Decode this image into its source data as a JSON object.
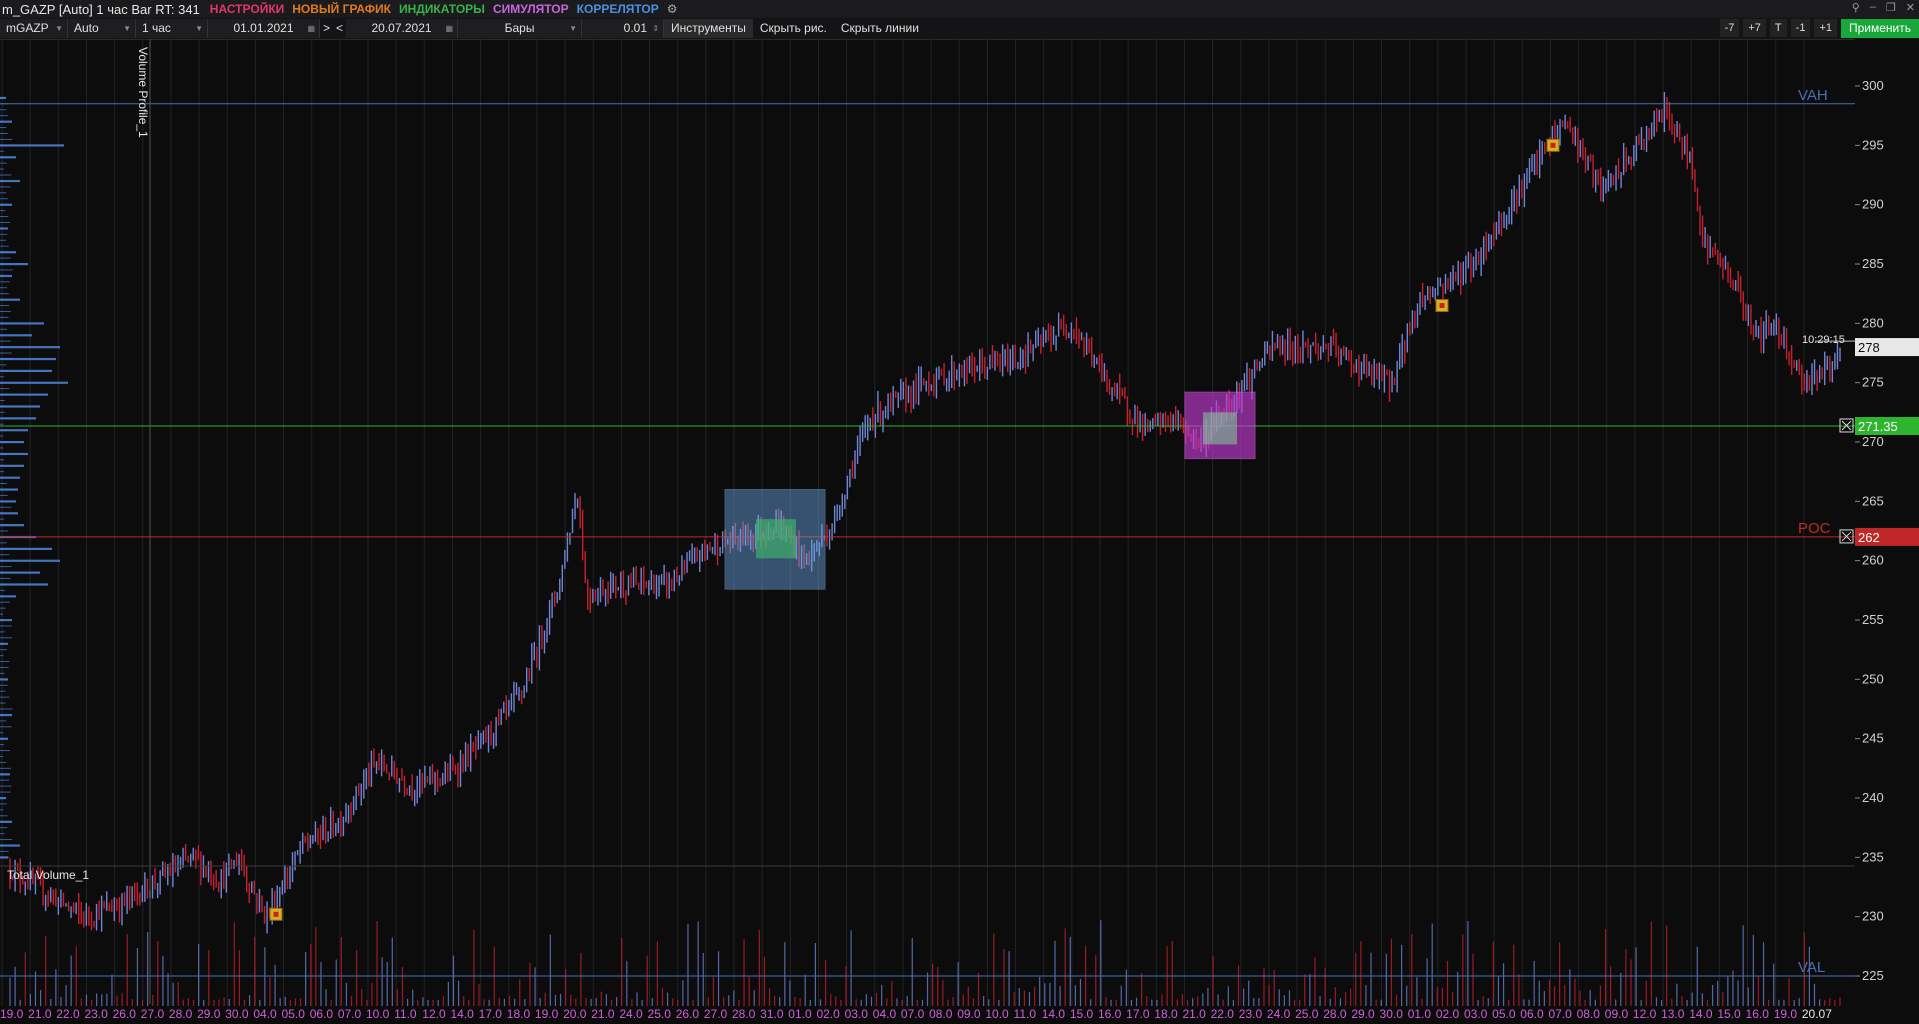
{
  "window": {
    "title": "m_GAZP [Auto] 1 час Bar RT: 341",
    "menus": [
      {
        "label": "НАСТРОЙКИ",
        "color": "#e2366b"
      },
      {
        "label": "НОВЫЙ ГРАФИК",
        "color": "#e07a22"
      },
      {
        "label": "ИНДИКАТОРЫ",
        "color": "#35b24a"
      },
      {
        "label": "СИМУЛЯТОР",
        "color": "#c765e0"
      },
      {
        "label": "КОРРЕЛЯТОР",
        "color": "#4a90e2"
      }
    ],
    "settings_icon": "gears-icon",
    "controls": [
      "pin-icon",
      "minimize-icon",
      "restore-icon",
      "close-icon"
    ]
  },
  "toolbar": {
    "symbol": "mGAZP",
    "scale": "Auto",
    "timeframe": "1 час",
    "date_from": "01.01.2021",
    "nav_forward": ">",
    "nav_back": "<",
    "date_to": "20.07.2021",
    "chart_type": "Бары",
    "step": "0.01",
    "instruments": "Инструменты",
    "hide_drawings": "Скрыть рис.",
    "hide_lines": "Скрыть линии",
    "right_buttons": [
      "-7",
      "+7",
      "T",
      "-1",
      "+1"
    ],
    "apply": "Применить"
  },
  "chart": {
    "panel_label": "Volume Profile_1",
    "volume_label": "Total Volume_1",
    "current_time": "10:29:15",
    "colors": {
      "up": "#6f86d6",
      "down": "#c8202d",
      "profile": "#4a7fd4",
      "grid": "#232326"
    },
    "levels": [
      {
        "name": "VAH",
        "price": 298.5,
        "color": "#4a6fb0",
        "label": "VAH"
      },
      {
        "name": "level",
        "price": 271.35,
        "color": "#2db52d",
        "tag": "271.35"
      },
      {
        "name": "POC",
        "price": 262,
        "color": "#c02828",
        "label": "POC",
        "tag": "262"
      },
      {
        "name": "VAL",
        "price": 225,
        "color": "#4a6fb0",
        "label": "VAL"
      }
    ],
    "price_ticks": [
      "300",
      "295",
      "290",
      "285",
      "280",
      "275",
      "270",
      "265",
      "260",
      "255",
      "250",
      "245",
      "240",
      "235",
      "230",
      "225"
    ],
    "current_price": "278",
    "date_ticks": [
      "19.0",
      "21.0",
      "22.0",
      "23.0",
      "26.0",
      "27.0",
      "28.0",
      "29.0",
      "30.0",
      "04.0",
      "05.0",
      "06.0",
      "07.0",
      "10.0",
      "11.0",
      "12.0",
      "14.0",
      "17.0",
      "18.0",
      "19.0",
      "20.0",
      "21.0",
      "24.0",
      "25.0",
      "26.0",
      "27.0",
      "28.0",
      "31.0",
      "01.0",
      "02.0",
      "03.0",
      "04.0",
      "07.0",
      "08.0",
      "09.0",
      "10.0",
      "11.0",
      "14.0",
      "15.0",
      "16.0",
      "17.0",
      "18.0",
      "21.0",
      "22.0",
      "23.0",
      "24.0",
      "25.0",
      "28.0",
      "29.0",
      "30.0",
      "01.0",
      "02.0",
      "03.0",
      "05.0",
      "06.0",
      "07.0",
      "08.0",
      "09.0",
      "12.0",
      "13.0",
      "14.0",
      "15.0",
      "16.0",
      "19.0",
      "20.07"
    ],
    "boxes": [
      {
        "name": "blue-zone-box",
        "color": "#6aa7e6"
      },
      {
        "name": "magenta-zone-box",
        "color": "#c23bd0"
      }
    ],
    "price_path": [
      [
        0,
        234
      ],
      [
        0.02,
        232
      ],
      [
        0.04,
        230
      ],
      [
        0.06,
        231
      ],
      [
        0.08,
        233
      ],
      [
        0.1,
        235
      ],
      [
        0.115,
        233
      ],
      [
        0.125,
        235
      ],
      [
        0.13,
        233
      ],
      [
        0.14,
        230
      ],
      [
        0.16,
        236
      ],
      [
        0.18,
        238
      ],
      [
        0.2,
        243
      ],
      [
        0.22,
        241
      ],
      [
        0.24,
        242
      ],
      [
        0.26,
        245
      ],
      [
        0.28,
        249
      ],
      [
        0.3,
        258
      ],
      [
        0.31,
        266
      ],
      [
        0.315,
        257
      ],
      [
        0.33,
        258
      ],
      [
        0.36,
        258
      ],
      [
        0.38,
        261
      ],
      [
        0.4,
        262
      ],
      [
        0.42,
        263
      ],
      [
        0.435,
        260
      ],
      [
        0.45,
        263
      ],
      [
        0.46,
        268
      ],
      [
        0.47,
        272
      ],
      [
        0.5,
        275
      ],
      [
        0.52,
        276
      ],
      [
        0.55,
        277
      ],
      [
        0.58,
        280
      ],
      [
        0.6,
        275
      ],
      [
        0.62,
        271
      ],
      [
        0.635,
        272
      ],
      [
        0.65,
        270
      ],
      [
        0.665,
        273
      ],
      [
        0.69,
        278
      ],
      [
        0.72,
        278
      ],
      [
        0.74,
        276
      ],
      [
        0.755,
        275
      ],
      [
        0.77,
        282
      ],
      [
        0.8,
        285
      ],
      [
        0.82,
        290
      ],
      [
        0.84,
        295
      ],
      [
        0.85,
        297
      ],
      [
        0.87,
        291
      ],
      [
        0.89,
        295
      ],
      [
        0.905,
        298
      ],
      [
        0.92,
        293
      ],
      [
        0.925,
        287
      ],
      [
        0.94,
        284
      ],
      [
        0.955,
        279
      ],
      [
        0.965,
        280
      ],
      [
        0.98,
        275
      ],
      [
        1.0,
        277
      ]
    ],
    "volume_profile": [
      [
        299,
        3
      ],
      [
        297,
        6
      ],
      [
        295,
        32
      ],
      [
        294,
        8
      ],
      [
        292,
        10
      ],
      [
        290,
        6
      ],
      [
        288,
        4
      ],
      [
        286,
        8
      ],
      [
        285,
        14
      ],
      [
        284,
        6
      ],
      [
        282,
        10
      ],
      [
        280,
        22
      ],
      [
        279,
        16
      ],
      [
        278,
        30
      ],
      [
        277,
        28
      ],
      [
        276,
        26
      ],
      [
        275,
        34
      ],
      [
        274,
        24
      ],
      [
        273,
        20
      ],
      [
        272,
        18
      ],
      [
        271,
        14
      ],
      [
        270,
        12
      ],
      [
        269,
        14
      ],
      [
        268,
        12
      ],
      [
        267,
        10
      ],
      [
        266,
        9
      ],
      [
        265,
        8
      ],
      [
        264,
        9
      ],
      [
        263,
        12
      ],
      [
        262,
        18
      ],
      [
        261,
        26
      ],
      [
        260,
        30
      ],
      [
        259,
        20
      ],
      [
        258,
        24
      ],
      [
        257,
        8
      ],
      [
        255,
        6
      ],
      [
        253,
        4
      ],
      [
        250,
        4
      ],
      [
        247,
        6
      ],
      [
        245,
        4
      ],
      [
        242,
        5
      ],
      [
        240,
        3
      ],
      [
        238,
        6
      ],
      [
        236,
        10
      ],
      [
        235,
        4
      ]
    ]
  }
}
